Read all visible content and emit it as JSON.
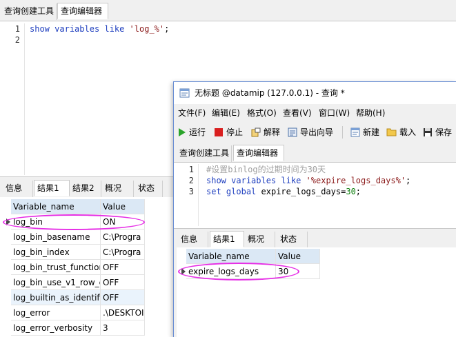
{
  "main_window": {
    "tabs": [
      {
        "label": "查询创建工具",
        "active": false
      },
      {
        "label": "查询编辑器",
        "active": true
      }
    ],
    "editor": {
      "line_numbers": [
        "1",
        "2"
      ],
      "line1": {
        "kw1": "show",
        "kw2": "variables",
        "kw3": "like",
        "str": "'log_%'",
        "end": ";"
      }
    },
    "result_tabs": [
      {
        "label": "信息",
        "active": false
      },
      {
        "label": "结果1",
        "active": true
      },
      {
        "label": "结果2",
        "active": false
      },
      {
        "label": "概况",
        "active": false
      },
      {
        "label": "状态",
        "active": false
      }
    ],
    "grid": {
      "columns": [
        "Variable_name",
        "Value"
      ],
      "rows": [
        [
          "log_bin",
          "ON"
        ],
        [
          "log_bin_basename",
          "C:\\Progra"
        ],
        [
          "log_bin_index",
          "C:\\Progra"
        ],
        [
          "log_bin_trust_function",
          "OFF"
        ],
        [
          "log_bin_use_v1_row_e",
          "OFF"
        ],
        [
          "log_builtin_as_identifie",
          "OFF"
        ],
        [
          "log_error",
          ".\\DESKTOI"
        ],
        [
          "log_error_verbosity",
          "3"
        ]
      ]
    }
  },
  "dialog": {
    "title": "无标题 @datamip (127.0.0.1) - 查询 *",
    "menu": [
      "文件(F)",
      "编辑(E)",
      "格式(O)",
      "查看(V)",
      "窗口(W)",
      "帮助(H)"
    ],
    "toolbar": {
      "run": "运行",
      "stop": "停止",
      "explain": "解释",
      "export": "导出向导",
      "new": "新建",
      "load": "载入",
      "save": "保存"
    },
    "tabs": [
      {
        "label": "查询创建工具",
        "active": false
      },
      {
        "label": "查询编辑器",
        "active": true
      }
    ],
    "editor": {
      "line_numbers": [
        "1",
        "2",
        "3"
      ],
      "line1_comment": "#设置binlog的过期时间为30天",
      "line2": {
        "kw1": "show",
        "kw2": "variables",
        "kw3": "like",
        "str": "'%expire_logs_days%'",
        "end": ";"
      },
      "line3": {
        "kw1": "set",
        "kw2": "global",
        "rest": "expire_logs_days=",
        "num": "30",
        "end": ";"
      }
    },
    "result_tabs": [
      {
        "label": "信息",
        "active": false
      },
      {
        "label": "结果1",
        "active": true
      },
      {
        "label": "概况",
        "active": false
      },
      {
        "label": "状态",
        "active": false
      }
    ],
    "grid": {
      "columns": [
        "Variable_name",
        "Value"
      ],
      "rows": [
        [
          "expire_logs_days",
          "30"
        ]
      ]
    }
  },
  "colors": {
    "highlight_ellipse": "#e62ee6",
    "keyword": "#1f3fbf",
    "string": "#8b1a1a",
    "comment": "#a0a0a0",
    "number": "#0b7d0b",
    "header_cell": "#dbe8f5"
  },
  "icons": {
    "app": "navicat-query-icon",
    "run": "play-icon",
    "stop": "stop-icon",
    "explain": "explain-icon",
    "export": "export-wizard-icon",
    "new": "new-query-icon",
    "load": "folder-icon",
    "save": "floppy-disk-icon"
  }
}
